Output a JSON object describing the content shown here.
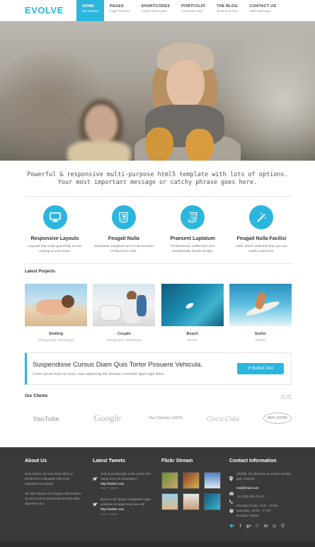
{
  "header": {
    "logo": "EVOLVE",
    "nav": [
      {
        "title": "HOME",
        "sub": "Get Started",
        "active": true
      },
      {
        "title": "PAGES",
        "sub": "Page Formats",
        "active": false
      },
      {
        "title": "SHORTCODES",
        "sub": "Useful Shortcodes",
        "active": false
      },
      {
        "title": "PORTFOLIO",
        "sub": "Awesome Stuff",
        "active": false
      },
      {
        "title": "THE BLOG",
        "sub": "News & Events",
        "active": false
      },
      {
        "title": "CONTACT US",
        "sub": "Write Message",
        "active": false
      }
    ]
  },
  "tagline": {
    "line1": "Powerful & responsive multi-purpose html5 template with lots of options.",
    "line2": "Your most important message or catchy phrase goes here."
  },
  "features": [
    {
      "icon": "monitor-icon",
      "title": "Responsive Layouts",
      "desc": "Layouts that scale gracefully across varying screen sizes."
    },
    {
      "icon": "html5-icon",
      "title": "Feugait Nulla",
      "desc": "Standards compliant and cross-browser HTML/CSS code."
    },
    {
      "icon": "css3-icon",
      "title": "Praesent Luptatum",
      "desc": "Professional, clutter-free and aesthetically simple design."
    },
    {
      "icon": "magic-wand-icon",
      "title": "Feugait Nulla Facilisi",
      "desc": "CMS driven websites that you can easily customize."
    }
  ],
  "projects": {
    "title": "Latest Projects",
    "items": [
      {
        "title": "Smiling",
        "sub": "Photography, Technology"
      },
      {
        "title": "Couple",
        "sub": "Photography, Webdesign"
      },
      {
        "title": "Beach",
        "sub": "Identity"
      },
      {
        "title": "Surfer",
        "sub": "Identity"
      }
    ]
  },
  "banner": {
    "title": "Suspendisse Cursus Diam Quis Tortor Posuere Vehicula.",
    "text": "Lorem ipsum dolor sit amet, cons adipiscing elit. Aenean commodo ligula eget dolor.",
    "button": "Button Text"
  },
  "clients": {
    "title": "Our Clients",
    "prev": "‹",
    "next": "›",
    "logos": [
      "YouTube",
      "Google",
      "Our Clients LOGO",
      "Coca-Cola",
      "WiFi ZONE"
    ]
  },
  "footer": {
    "about": {
      "title": "About Us",
      "p1": "Duis autem vel eum iriure dolor in hendrerit in vulputate velit esse molestie consequat.",
      "p2": "Vel illum dolore eu feugiat nulla facilisis at vero eros et accumsan et iusto odio dignissim qui."
    },
    "tweets": {
      "title": "Latest Tweets",
      "items": [
        {
          "text": "Sed ut perspiciatis unde omnis iste natus error sit voluptatem",
          "link": "http://twitter.com",
          "date": "Jun 7, 2013"
        },
        {
          "text": "Nemo enim ipsam voluptatem quia voluptas sit aspernatur aut odit",
          "link": "http://twitter.com",
          "date": "Jun 7, 2013"
        }
      ]
    },
    "flickr": {
      "title": "Flickr Stream"
    },
    "contact": {
      "title": "Contact Information",
      "address": "100/88, Ut wisi enim ad minim veniam, quis nostrud.",
      "email": "mail@mail.com",
      "phone": "+1 (229) 991-22-11",
      "hours": "Monday-Friday: 9:00 - 18:00",
      "saturday": "Saturday: 10:00 - 17:00",
      "sunday": "Sunday: closed"
    },
    "social_icons": [
      "twitter-icon",
      "facebook-icon",
      "google-plus-icon",
      "pinterest-icon",
      "linkedin-icon",
      "dribbble-icon",
      "rss-icon"
    ]
  },
  "colors": {
    "accent": "#2bb6dd",
    "footer_bg": "#3a3a3a"
  }
}
